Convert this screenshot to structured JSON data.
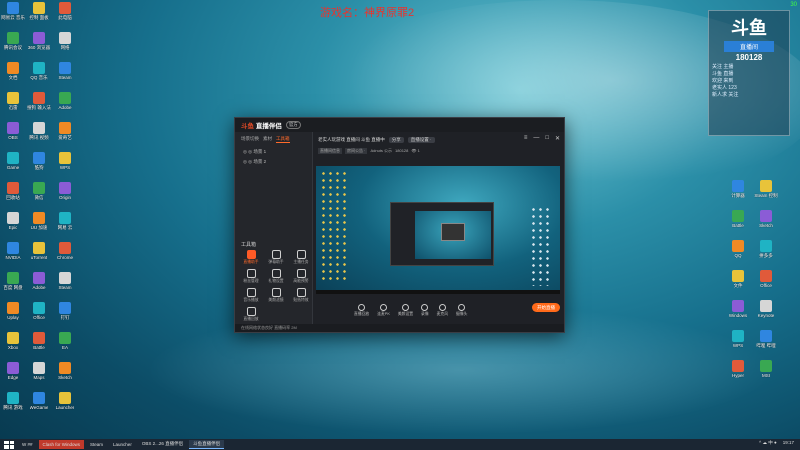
{
  "watermark_title": "游戏名：神界原罪2",
  "logo": {
    "brand": "斗鱼",
    "plate": "直播间",
    "room_id": "180128",
    "fps": "30"
  },
  "logo_fine": [
    "关注 主播",
    "斗鱼 直播",
    "欢迎 来到",
    "老实人 123",
    "新人求 关注"
  ],
  "desktop_left": [
    [
      "网易云 音乐",
      "控制 面板",
      "此电脑"
    ],
    [
      "腾讯会议",
      "360 浏览器",
      "网络"
    ],
    [
      "文档",
      "QQ 音乐",
      "Steam"
    ],
    [
      "迅雷",
      "搜狗 输入法",
      "Adobe"
    ],
    [
      "OBS",
      "腾讯 视频",
      "爱奇艺"
    ],
    [
      "Game",
      "酷狗",
      "WPS"
    ],
    [
      "回收站",
      "微信",
      "Origin"
    ],
    [
      "Epic",
      "UU 加速",
      "网易 云"
    ],
    [
      "NVIDIA",
      "uTorrent",
      "Chrome"
    ],
    [
      "百度 网盘",
      "Adobe",
      "Steam"
    ],
    [
      "Uplay",
      "Office",
      "钉钉"
    ],
    [
      "Xbox",
      "Battle",
      "EA"
    ],
    [
      "Edge",
      "Maps",
      "Sketch"
    ],
    [
      "腾讯 游戏",
      "WeGame",
      "Launcher"
    ]
  ],
  "desktop_right": [
    [
      "计算器",
      "Steam 控制"
    ],
    [
      "Battle",
      "Sketch"
    ],
    [
      "QQ",
      "拼多多"
    ],
    [
      "文件",
      "Office"
    ],
    [
      "Windows",
      "Keynote"
    ],
    [
      "WPS",
      "哔哩 哔哩"
    ],
    [
      "Hyper",
      "MSI"
    ]
  ],
  "app": {
    "logo_text": "直播伴侣",
    "logo_mark": "斗鱼",
    "pill": "官方",
    "tabs": [
      "场景切换",
      "素材",
      "工具箱"
    ],
    "scenes": [
      "◎ ◎ 场景 1",
      "◎ ◎ 场景 2"
    ],
    "tools_header": "工具箱",
    "tools": [
      "直播助手",
      "弹幕助手",
      "主播任务",
      "粉丝管理",
      "礼物设置",
      "高能预警",
      "音乐播放",
      "美颜滤镜",
      "贴纸特效",
      "直播回放"
    ],
    "status": "在线网络状态良好 直播码率 2M",
    "room_title": "老实人玩游戏 直播间 斗鱼 直播中",
    "room_chips": [
      "分享",
      "直播设置 ·"
    ],
    "sub_chips": [
      "直播间信息",
      "房间公告 ·",
      "Adnuts 公示",
      "180128",
      "👁 1"
    ],
    "window_controls": [
      "≡",
      "—",
      "□",
      "✕"
    ],
    "controls": [
      "直播回放",
      "连麦PK",
      "美颜设置",
      "录像",
      "麦克风",
      "摄像头"
    ],
    "live_button": "开始直播"
  },
  "taskbar": {
    "items": [
      "W ##",
      "Clash for Windows",
      "Steam",
      "Launcher",
      "OBS 2...26 直播伴侣",
      "斗鱼直播伴侣"
    ],
    "tray": [
      "^ ☁ 中 ●",
      "19:17"
    ]
  }
}
